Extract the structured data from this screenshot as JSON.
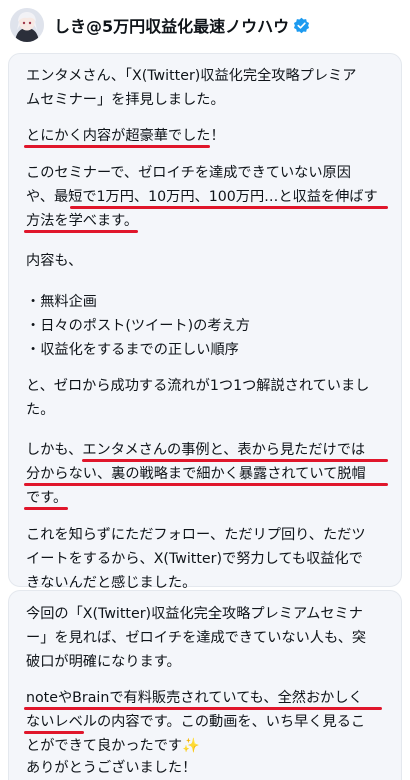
{
  "tweet": {
    "author": "しき@5万円収益化最速ノウハウ",
    "verified": true,
    "badge_color": "#1d9bf0",
    "icons": {
      "avatar": "avatar-icon",
      "verified": "verified-badge-icon",
      "sparkle": "sparkle-icon"
    }
  },
  "card1": {
    "lines": [
      "エンタメさん、「X(Twitter)収益化完全攻略プレミア",
      "ムセミナー」を拝見しました。",
      "とにかく内容が超豪華でした！",
      "このセミナーで、ゼロイチを達成できていない原因",
      "や、最短で1万円、10万円、100万円…と収益を伸ばす",
      "方法を学べます。",
      "内容も、",
      "・無料企画",
      "・日々のポスト(ツイート)の考え方",
      "・収益化をするまでの正しい順序",
      "と、ゼロから成功する流れが1つ1つ解説されていまし",
      "た。",
      "しかも、エンタメさんの事例と、表から見ただけでは",
      "分からない、裏の戦略まで細かく暴露されていて脱帽",
      "です。",
      "これを知らずにただフォロー、ただリプ回り、ただツ",
      "イートをするから、X(Twitter)で努力しても収益化で",
      "きないんだと感じました。"
    ]
  },
  "card2": {
    "lines": [
      "今回の「X(Twitter)収益化完全攻略プレミアムセミナ",
      "ー」を見れば、ゼロイチを達成できていない人も、突",
      "破口が明確になります。",
      "noteやBrainで有料販売されていても、全然おかしく",
      "ないレベルの内容です。この動画を、いち早く見るこ",
      "とができて良かったです",
      "ありがとうございました！"
    ],
    "sparkle": "✨"
  },
  "highlight_color": "#e0162b"
}
